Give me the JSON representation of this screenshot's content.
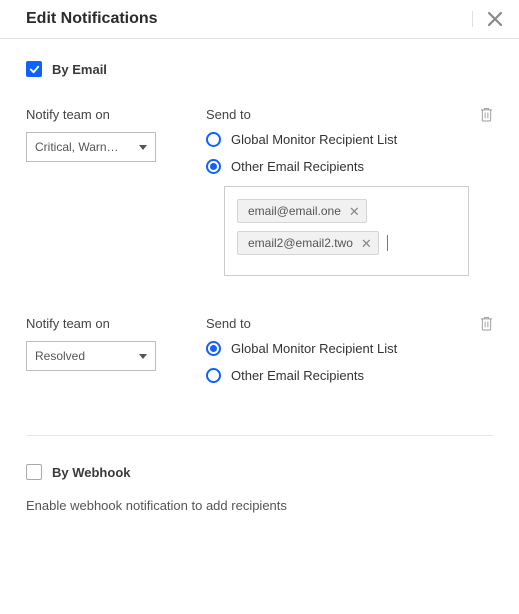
{
  "header": {
    "title": "Edit Notifications"
  },
  "byEmail": {
    "label": "By Email",
    "checked": true
  },
  "block1": {
    "notifyLabel": "Notify team on",
    "selectValue": "Critical, Warn…",
    "sendToLabel": "Send to",
    "options": {
      "global": "Global Monitor Recipient List",
      "other": "Other Email Recipients"
    },
    "selected": "other",
    "chips": [
      "email@email.one",
      "email2@email2.two"
    ]
  },
  "block2": {
    "notifyLabel": "Notify team on",
    "selectValue": "Resolved",
    "sendToLabel": "Send to",
    "options": {
      "global": "Global Monitor Recipient List",
      "other": "Other Email Recipients"
    },
    "selected": "global"
  },
  "byWebhook": {
    "label": "By Webhook",
    "checked": false,
    "hint": "Enable webhook notification to add recipients"
  }
}
